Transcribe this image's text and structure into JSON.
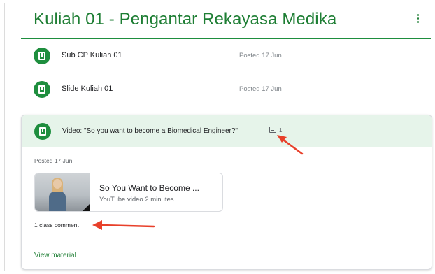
{
  "topic": {
    "title": "Kuliah 01 - Pengantar Rekayasa Medika",
    "menu_icon": "more-vert-icon"
  },
  "materials": [
    {
      "label": "Sub CP Kuliah 01",
      "posted": "Posted 17 Jun",
      "icon": "material-icon"
    },
    {
      "label": "Slide Kuliah 01",
      "posted": "Posted 17 Jun",
      "icon": "material-icon"
    }
  ],
  "expanded_material": {
    "label": "Video: \"So you want to become a Biomedical Engineer?\"",
    "comment_count": "1",
    "posted": "Posted 17 Jun",
    "attachment": {
      "title": "So You Want to Become ...",
      "subtitle": "YouTube video  2 minutes"
    },
    "class_comment": "1 class comment",
    "view_material": "View material"
  },
  "colors": {
    "accent": "#1e7e34",
    "expanded_header_bg": "#e6f4ea",
    "annotation_arrow": "#e8402a"
  }
}
